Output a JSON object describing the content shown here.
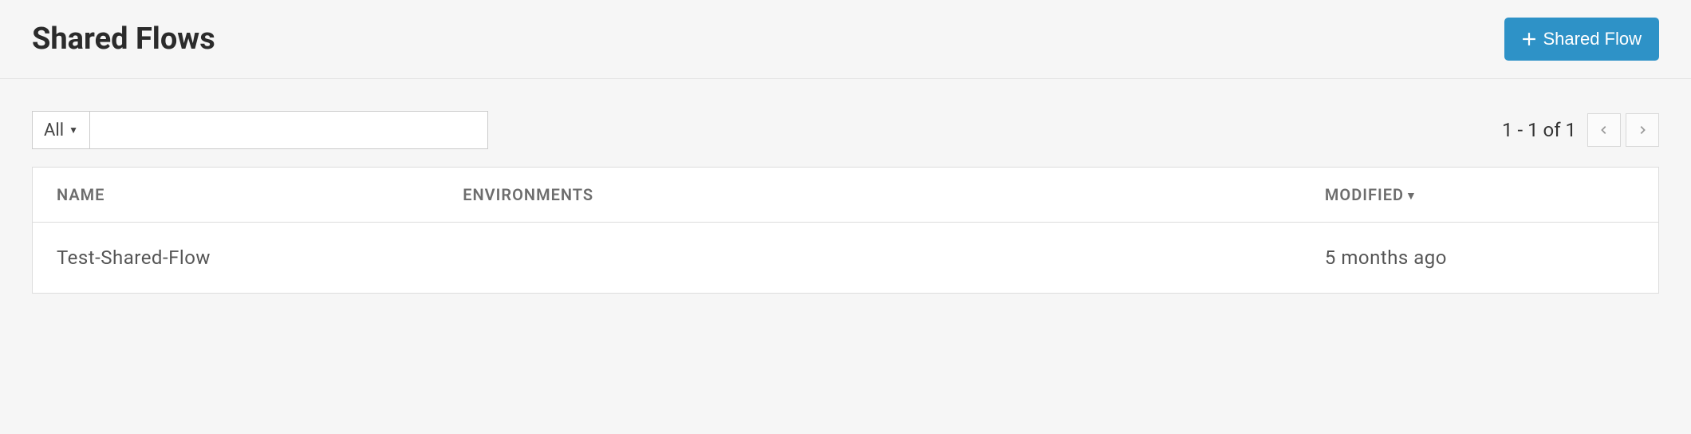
{
  "header": {
    "title": "Shared Flows",
    "create_button_label": "Shared Flow"
  },
  "filter": {
    "selected_label": "All",
    "search_value": ""
  },
  "pager": {
    "range_text": "1 - 1 of 1"
  },
  "table": {
    "columns": {
      "name": "NAME",
      "environments": "ENVIRONMENTS",
      "modified": "MODIFIED"
    },
    "sort_indicator": "▼",
    "rows": [
      {
        "name": "Test-Shared-Flow",
        "environments": "",
        "modified": "5 months ago"
      }
    ]
  }
}
